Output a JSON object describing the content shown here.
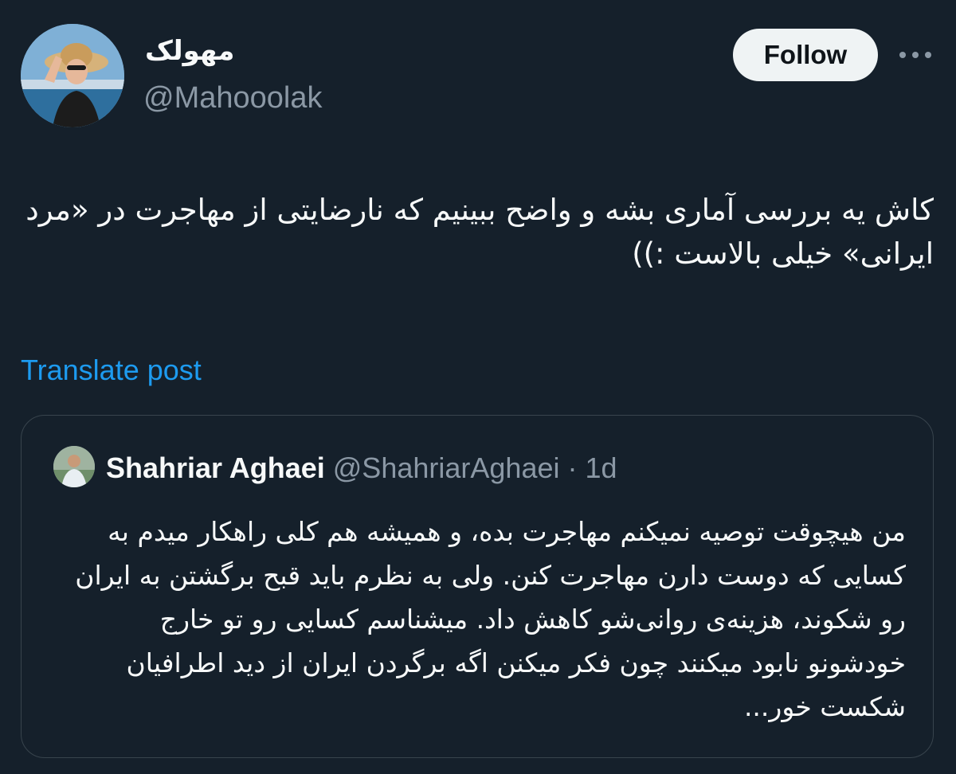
{
  "author": {
    "display_name": "مهولک",
    "handle": "@Mahooolak"
  },
  "follow_label": "Follow",
  "more_icon": "more-horizontal-icon",
  "tweet_text": "کاش یه بررسی آماری بشه و واضح ببینیم که نارضایتی از مهاجرت در «مرد ایرانی» خیلی بالاست :))",
  "translate_label": "Translate post",
  "quote": {
    "display_name": "Shahriar Aghaei",
    "handle": "@ShahriarAghaei",
    "separator": " · ",
    "time": "1d",
    "text": "من هیچوقت توصیه نمیکنم مهاجرت بده، و همیشه هم کلی راهکار میدم به کسایی که دوست دارن مهاجرت کنن. ولی به نظرم باید قبح برگشتن به ایران رو شکوند، هزینه‌ی روانی‌شو کاهش داد. میشناسم کسایی رو تو خارج خودشونو نابود میکنند چون فکر میکنن اگه برگردن ایران از دید اطرافیان شکست خور..."
  },
  "colors": {
    "background": "#15202b",
    "text": "#f7f9f9",
    "secondary_text": "#8b98a5",
    "link": "#1d9bf0",
    "follow_button_bg": "#eff3f4",
    "border": "#38444d"
  }
}
